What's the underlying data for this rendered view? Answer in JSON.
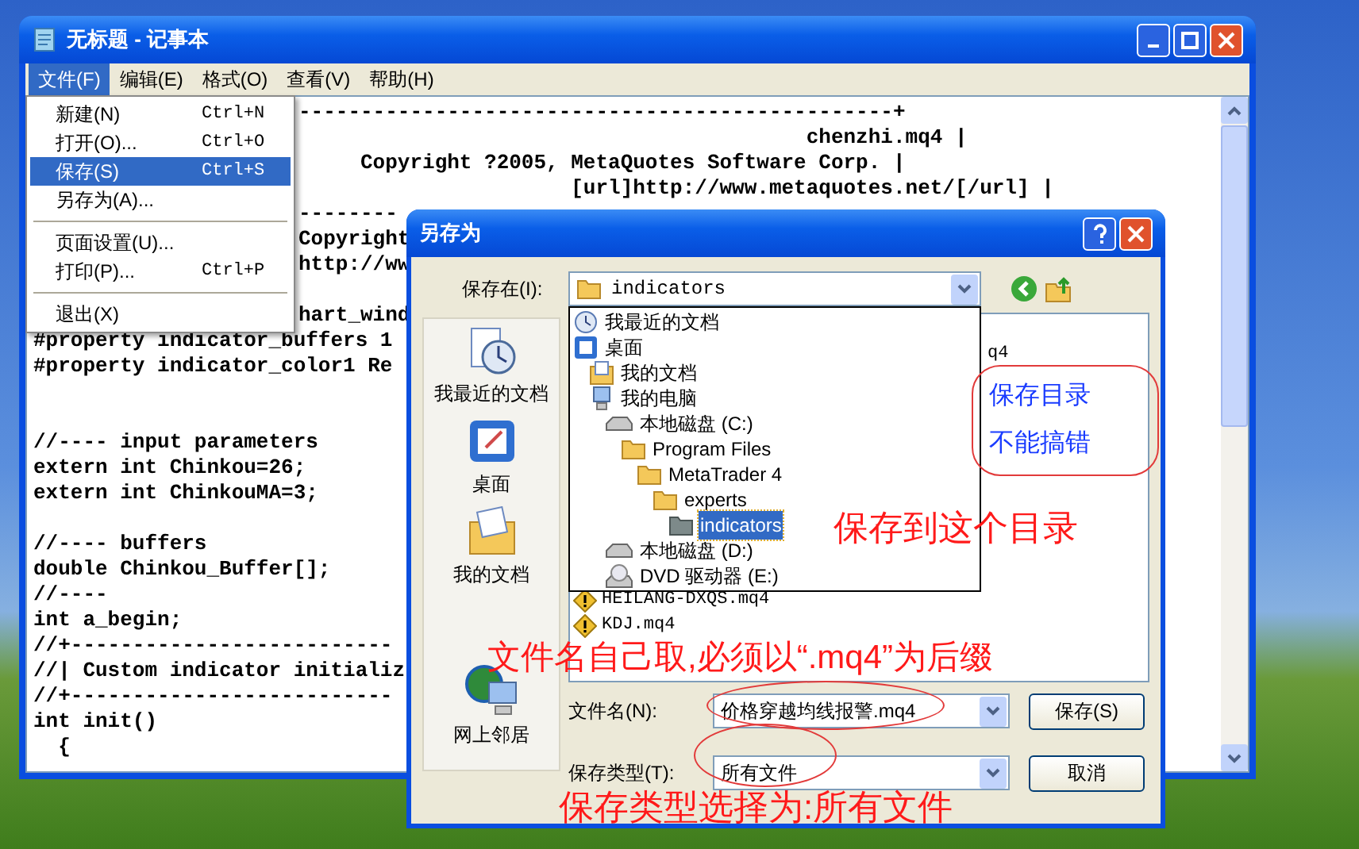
{
  "notepad": {
    "title": "无标题 - 记事本",
    "menu": [
      {
        "label": "文件(F)",
        "selected": true
      },
      {
        "label": "编辑(E)",
        "selected": false
      },
      {
        "label": "格式(O)",
        "selected": false
      },
      {
        "label": "查看(V)",
        "selected": false
      },
      {
        "label": "帮助(H)",
        "selected": false
      }
    ],
    "file_menu": [
      [
        {
          "label": "新建(N)",
          "shortcut": "Ctrl+N",
          "selected": false
        },
        {
          "label": "打开(O)...",
          "shortcut": "Ctrl+O",
          "selected": false
        },
        {
          "label": "保存(S)",
          "shortcut": "Ctrl+S",
          "selected": true
        },
        {
          "label": "另存为(A)...",
          "selected": false
        }
      ],
      [
        {
          "label": "页面设置(U)...",
          "selected": false
        },
        {
          "label": "打印(P)...",
          "shortcut": "Ctrl+P",
          "selected": false
        }
      ],
      [
        {
          "label": "退出(X)",
          "selected": false
        }
      ]
    ],
    "editor_lines": [
      {
        "kind": "after-menu",
        "text": "------------------------------------------------+"
      },
      {
        "kind": "after-menu",
        "text": "                                         chenzhi.mq4 |"
      },
      {
        "kind": "after-menu",
        "text": "     Copyright ?2005, MetaQuotes Software Corp. |"
      },
      {
        "kind": "after-menu",
        "text": "                      [url]http://www.metaquotes.net/[/url] |"
      },
      {
        "kind": "after-menu",
        "text": "--------"
      },
      {
        "kind": "after-menu",
        "text": "Copyright"
      },
      {
        "kind": "after-menu",
        "text": "http://ww"
      },
      {
        "kind": "blank"
      },
      {
        "kind": "after-menu",
        "text": "hart_wind"
      },
      {
        "kind": "code",
        "text": "#property indicator_buffers 1"
      },
      {
        "kind": "code",
        "text": "#property indicator_color1 Re"
      },
      {
        "kind": "blank"
      },
      {
        "kind": "blank"
      },
      {
        "kind": "code",
        "text": "//---- input parameters"
      },
      {
        "kind": "code",
        "text": "extern int Chinkou=26;"
      },
      {
        "kind": "code",
        "text": "extern int ChinkouMA=3;"
      },
      {
        "kind": "blank"
      },
      {
        "kind": "code",
        "text": "//---- buffers"
      },
      {
        "kind": "code",
        "text": "double Chinkou_Buffer[];"
      },
      {
        "kind": "code",
        "text": "//----"
      },
      {
        "kind": "code",
        "text": "int a_begin;"
      },
      {
        "kind": "code",
        "text": "//+--------------------------"
      },
      {
        "kind": "code",
        "text": "//| Custom indicator initializ"
      },
      {
        "kind": "code",
        "text": "//+--------------------------"
      },
      {
        "kind": "code",
        "text": "int init()"
      },
      {
        "kind": "code",
        "text": "  {"
      }
    ]
  },
  "save_dialog": {
    "title": "另存为",
    "save_in_label": "保存在(I):",
    "save_in_value": "indicators",
    "location_tree": [
      {
        "label": "我最近的文档",
        "kind": "recent",
        "selected": false
      },
      {
        "label": "桌面",
        "kind": "desktop",
        "selected": false,
        "children": [
          {
            "label": "我的文档",
            "kind": "documents",
            "selected": false
          },
          {
            "label": "我的电脑",
            "kind": "computer",
            "selected": false,
            "children": [
              {
                "label": "本地磁盘 (C:)",
                "kind": "drive",
                "selected": false,
                "children": [
                  {
                    "label": "Program Files",
                    "kind": "folder",
                    "selected": false,
                    "children": [
                      {
                        "label": "MetaTrader 4",
                        "kind": "folder",
                        "selected": false,
                        "children": [
                          {
                            "label": "experts",
                            "kind": "folder",
                            "selected": false,
                            "children": [
                              {
                                "label": "indicators",
                                "kind": "folder",
                                "selected": true
                              }
                            ]
                          }
                        ]
                      }
                    ]
                  }
                ]
              },
              {
                "label": "本地磁盘 (D:)",
                "kind": "drive",
                "selected": false
              },
              {
                "label": "DVD 驱动器 (E:)",
                "kind": "cd",
                "selected": false
              }
            ]
          }
        ]
      }
    ],
    "places": [
      {
        "label": "我最近的文档",
        "kind": "recent"
      },
      {
        "label": "桌面",
        "kind": "desktop"
      },
      {
        "label": "我的文档",
        "kind": "documents"
      },
      {
        "label": "网上邻居",
        "kind": "network"
      }
    ],
    "partial_file": "q4",
    "files": [
      "HEILANG-DXQS.mq4",
      "KDJ.mq4"
    ],
    "file_name_label": "文件名(N):",
    "file_name": "价格穿越均线报警.mq4",
    "file_type_label": "保存类型(T):",
    "file_type": "所有文件",
    "buttons": [
      "保存(S)",
      "取消"
    ]
  },
  "annotations": {
    "note_box": [
      "保存目录",
      "不能搞错"
    ],
    "folder_note": "保存到这个目录",
    "file_name_note": "文件名自己取,必须以“.mq4”为后缀",
    "file_type_note": "保存类型选择为:所有文件"
  }
}
